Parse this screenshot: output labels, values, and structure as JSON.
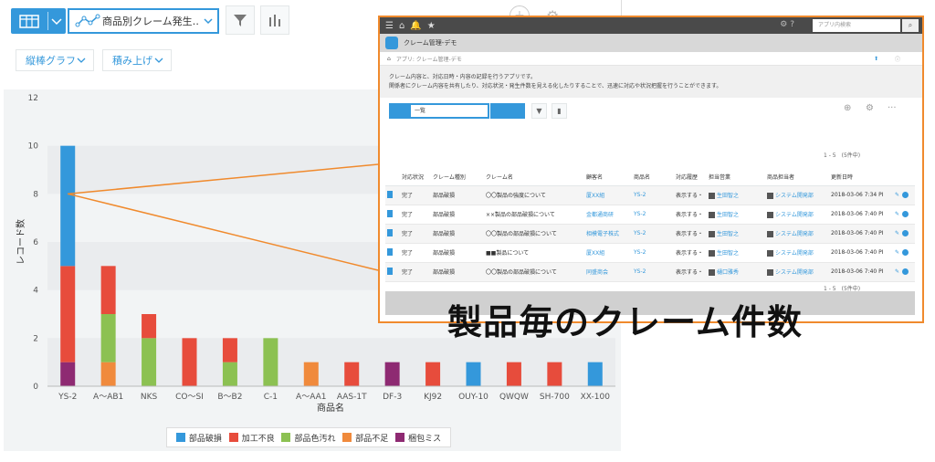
{
  "toolbar": {
    "graph_select_label": "商品別クレーム発生…",
    "chart_type_dropdown": "縦棒グラフ",
    "stack_dropdown": "積み上げ"
  },
  "chart_data": {
    "type": "bar",
    "stacked": true,
    "title": "",
    "xlabel": "商品名",
    "ylabel": "レコード数",
    "ylim": [
      0,
      12
    ],
    "yticks": [
      0,
      2,
      4,
      6,
      8,
      10,
      12
    ],
    "categories": [
      "YS-2",
      "A～AB1",
      "NKS",
      "CO～SI",
      "B～B2",
      "C-1",
      "A～AA1",
      "AAS-1T",
      "DF-3",
      "KJ92",
      "OUY-10",
      "QWQW",
      "SH-700",
      "XX-100"
    ],
    "series": [
      {
        "name": "梱包ミス",
        "color": "#8e2a72",
        "values": [
          1,
          0,
          0,
          0,
          0,
          0,
          0,
          0,
          1,
          0,
          0,
          0,
          0,
          0
        ]
      },
      {
        "name": "部品不足",
        "color": "#f08a3c",
        "values": [
          0,
          1,
          0,
          0,
          0,
          0,
          1,
          0,
          0,
          0,
          0,
          0,
          0,
          0
        ]
      },
      {
        "name": "部品色汚れ",
        "color": "#8cc152",
        "values": [
          0,
          2,
          2,
          0,
          1,
          2,
          0,
          0,
          0,
          0,
          0,
          0,
          0,
          0
        ]
      },
      {
        "name": "加工不良",
        "color": "#e74c3c",
        "values": [
          4,
          2,
          1,
          2,
          1,
          0,
          0,
          1,
          0,
          1,
          0,
          1,
          1,
          0
        ]
      },
      {
        "name": "部品破損",
        "color": "#3498db",
        "values": [
          5,
          0,
          0,
          0,
          0,
          0,
          0,
          0,
          0,
          0,
          1,
          0,
          0,
          1
        ]
      }
    ],
    "legend": [
      "部品破損",
      "加工不良",
      "部品色汚れ",
      "部品不足",
      "梱包ミス"
    ],
    "grid": true,
    "legend_position": "bottom"
  },
  "overlay": {
    "search_placeholder": "アプリ内検索",
    "app_name": "クレーム管理-デモ",
    "breadcrumb": "アプリ: クレーム管理-デモ",
    "desc_line1": "クレーム内容と、対応日時・内容の記録を行うアプリです。",
    "desc_line2": "関係者にクレーム内容を共有したり、対応状況・発生件数を見える化したりすることで、迅速に対応や状況把握を行うことができます。",
    "view_label": "一覧",
    "count_top": "1 - 5　(5件中)",
    "count_bottom": "1 - 5　(5件中)",
    "headers": [
      "対応状況",
      "クレーム種別",
      "クレーム名",
      "顧客名",
      "商品名",
      "対応履歴",
      "担当営業",
      "商品担当者",
      "更新日時"
    ],
    "rows": [
      {
        "status": "完了",
        "kind": "部品破損",
        "name": "〇〇製品の強度について",
        "customer": "厦XX組",
        "product": "YS-2",
        "history": "表示する・",
        "sales": "生田智之",
        "owner": "システム開発部",
        "updated": "2018-03-06 7:34 PI"
      },
      {
        "status": "完了",
        "kind": "部品破損",
        "name": "××製品の部品破損について",
        "customer": "金都通商研",
        "product": "YS-2",
        "history": "表示する・",
        "sales": "生田智之",
        "owner": "システム開発部",
        "updated": "2018-03-06 7:40 PI"
      },
      {
        "status": "完了",
        "kind": "部品破損",
        "name": "〇〇製品の部品破損について",
        "customer": "相模電子株式",
        "product": "YS-2",
        "history": "表示する・",
        "sales": "生田智之",
        "owner": "システム開発部",
        "updated": "2018-03-06 7:40 PI"
      },
      {
        "status": "完了",
        "kind": "部品破損",
        "name": "■■製品について",
        "customer": "厦XX組",
        "product": "YS-2",
        "history": "表示する・",
        "sales": "生田智之",
        "owner": "システム開発部",
        "updated": "2018-03-06 7:40 PI"
      },
      {
        "status": "完了",
        "kind": "部品破損",
        "name": "〇〇製品の部品破損について",
        "customer": "同盛商会",
        "product": "YS-2",
        "history": "表示する・",
        "sales": "樋口雅秀",
        "owner": "システム開発部",
        "updated": "2018-03-06 7:40 PI"
      }
    ]
  },
  "caption": "製品毎のクレーム件数"
}
